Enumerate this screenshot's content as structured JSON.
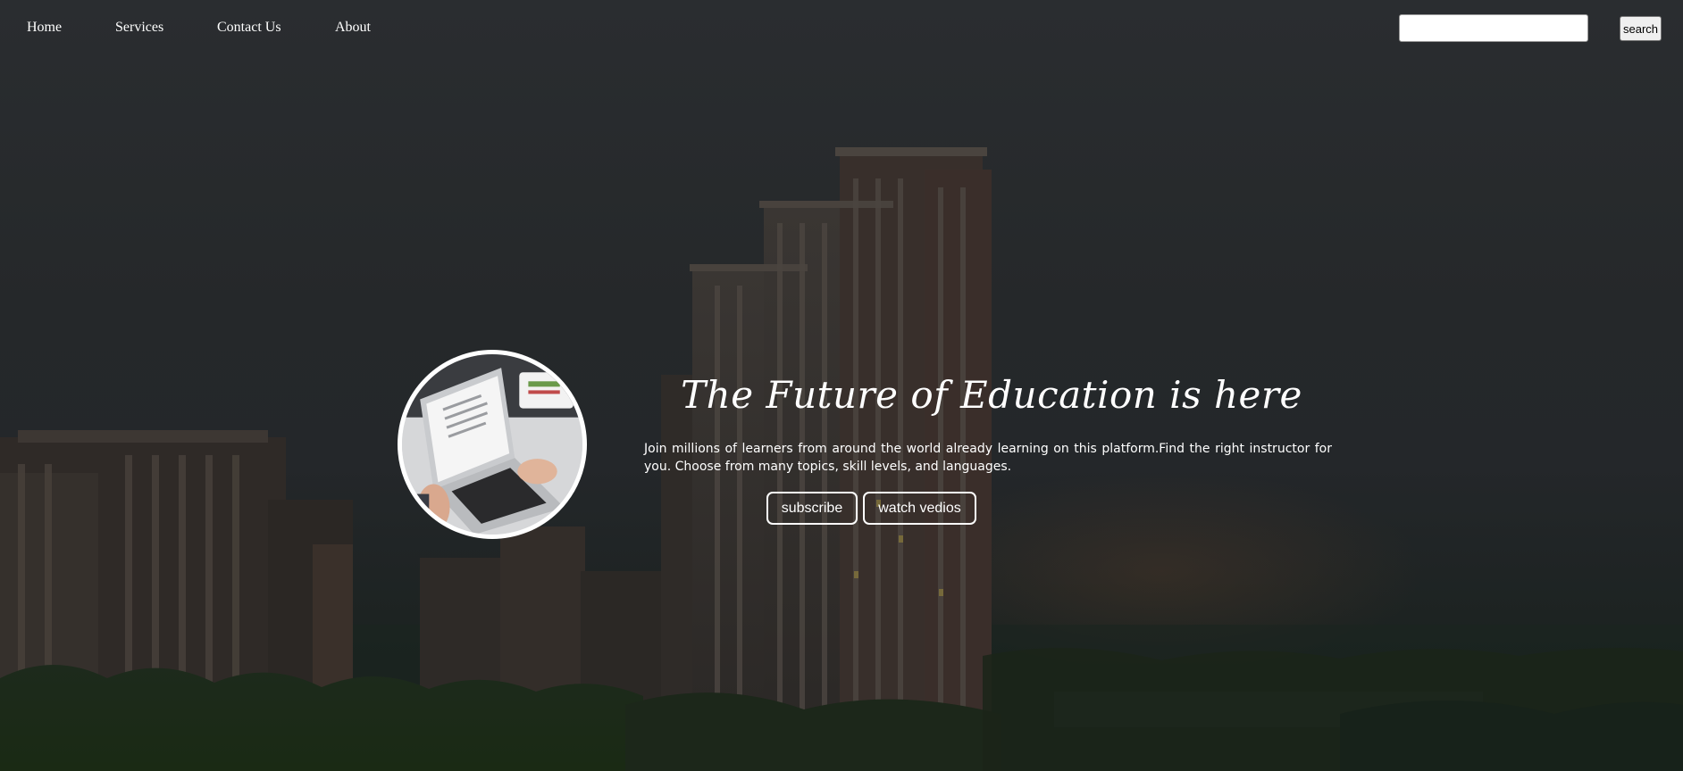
{
  "nav": {
    "items": [
      {
        "label": "Home"
      },
      {
        "label": "Services"
      },
      {
        "label": "Contact Us"
      },
      {
        "label": "About"
      }
    ],
    "search": {
      "value": "",
      "placeholder": "",
      "button_label": "search"
    }
  },
  "hero": {
    "title": "The Future of Education is here",
    "description": "Join millions of learners from around the world already learning on this platform.Find the right instructor for you. Choose from many topics, skill levels, and languages.",
    "buttons": {
      "subscribe": "subscribe",
      "watch": "watch vedios"
    },
    "image_alt": "laptop-photo"
  },
  "colors": {
    "text": "#ffffff",
    "background": "#24272a"
  }
}
